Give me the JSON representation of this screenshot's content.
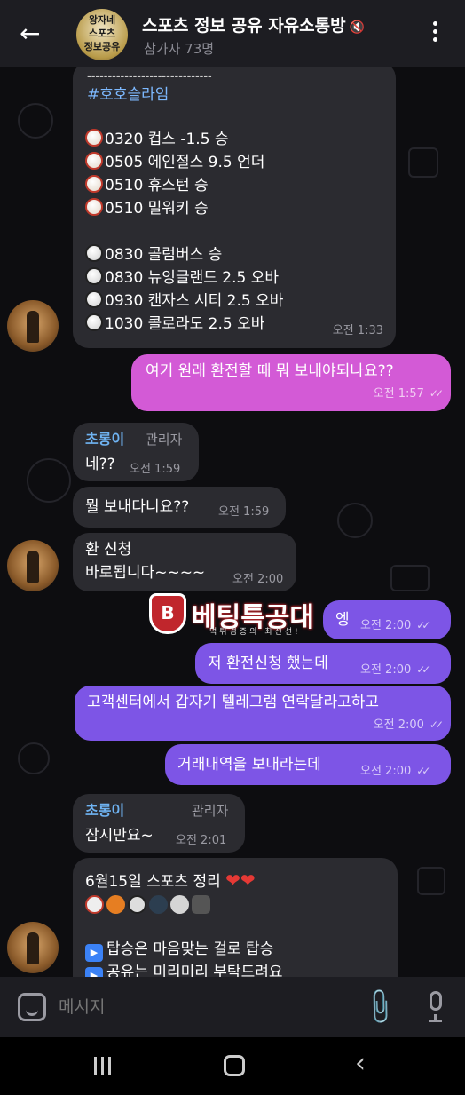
{
  "header": {
    "back_icon": "arrow-left-icon",
    "avatar_lines": [
      "왕자네",
      "스포츠",
      "정보공유"
    ],
    "title": "스포츠 정보 공유 자유소통방",
    "mute_icon": "speaker-muted-icon",
    "subtitle": "참가자 73명",
    "menu_icon": "more-vertical-icon"
  },
  "messages": {
    "m1": {
      "divider": "------------------------------",
      "hashtag": "#호호슬라임",
      "baseball": [
        "0320 컵스 -1.5 승",
        "0505 에인절스 9.5 언더",
        "0510 휴스턴 승",
        "0510 밀워키 승"
      ],
      "soccer": [
        "0830 콜럼버스 승",
        "0830 뉴잉글랜드 2.5 오바",
        "0930 캔자스 시티 2.5 오바",
        "1030 콜로라도 2.5 오바"
      ],
      "time": "오전 1:33"
    },
    "m2": {
      "text": "여기 원래 환전할 때 뭐 보내야되나요??",
      "time": "오전 1:57"
    },
    "m3": {
      "sender": "초롱이",
      "role": "관리자",
      "text": "네??",
      "time": "오전 1:59"
    },
    "m4": {
      "text": "뭘 보내다니요??",
      "time": "오전 1:59"
    },
    "m5": {
      "line1": "환 신청",
      "line2": "바로됩니다~~~~",
      "time": "오전 2:00"
    },
    "m6": {
      "text": "엥",
      "time": "오전 2:00"
    },
    "m7": {
      "text": "저 환전신청 했는데",
      "time": "오전 2:00"
    },
    "m8": {
      "text": "고객센터에서 갑자기 텔레그램 연락달라고하고",
      "time": "오전 2:00"
    },
    "m9": {
      "text": "거래내역을 보내라는데",
      "time": "오전 2:00"
    },
    "m10": {
      "sender": "초롱이",
      "role": "관리자",
      "text": "잠시만요~",
      "time": "오전 2:01"
    },
    "m11": {
      "line1": "6월15일 스포츠 정리",
      "line3": "탑승은 마음맞는 걸로 탑승",
      "line4": "공유는 미리미리 부탁드려요"
    }
  },
  "watermark": {
    "badge": "B",
    "text": "베팅특공대",
    "sub": "먹튀검증의 최전선!"
  },
  "input": {
    "placeholder": "메시지"
  },
  "colors": {
    "header_bg": "#1d1d22",
    "incoming": "#2b2b30",
    "outgoing_pink": "#d35ad6",
    "outgoing_purple": "#7d55e6",
    "sender_name": "#6fb3f2"
  }
}
